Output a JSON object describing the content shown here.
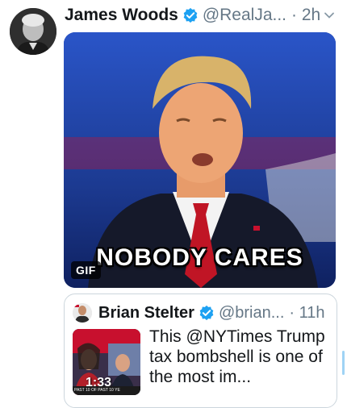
{
  "tweet": {
    "author_name": "James Woods",
    "handle": "@RealJa...",
    "time": "· 2h",
    "verified": true,
    "media": {
      "type_badge": "GIF",
      "caption": "NOBODY CARES"
    }
  },
  "quoted_tweet": {
    "author_name": "Brian Stelter",
    "handle": "@brian...",
    "time": "· 11h",
    "verified": true,
    "video_duration": "1:33",
    "ticker_text": "PAST 10 OF PAST 10 YE",
    "text": "This @NYTimes Trump tax bombshell is one of the most im..."
  },
  "colors": {
    "accent": "#1da1f2",
    "muted": "#657786",
    "border": "#ccd6dd"
  },
  "icons": {
    "verified": "verified-badge-icon",
    "chevron": "chevron-down-icon"
  }
}
